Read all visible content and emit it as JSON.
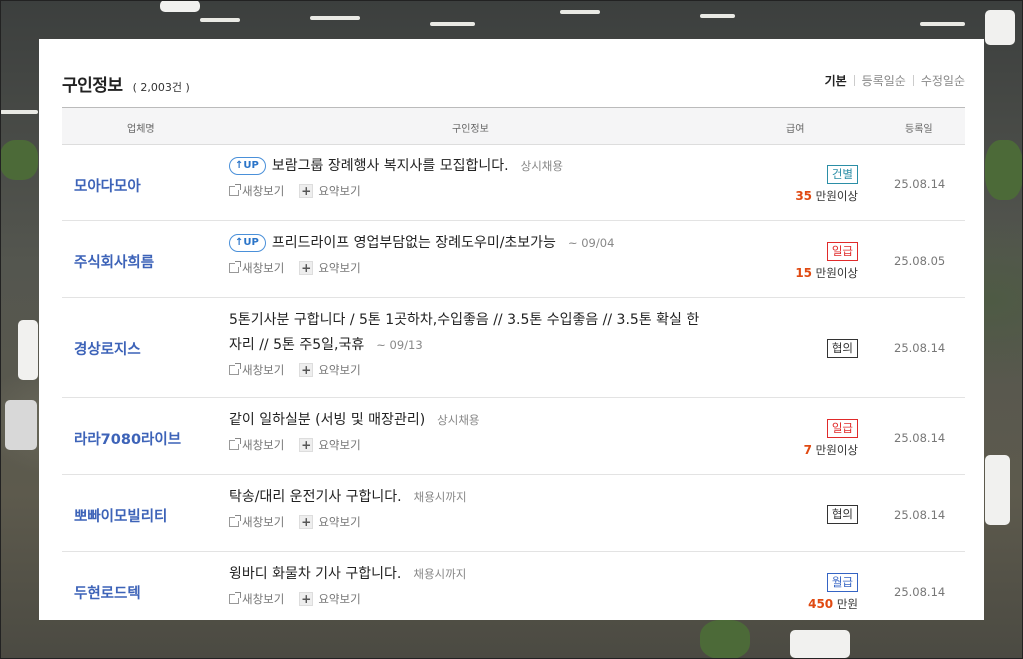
{
  "header": {
    "title": "구인정보",
    "count": "( 2,003건 )"
  },
  "sort_options": [
    {
      "label": "기본",
      "active": true
    },
    {
      "label": "등록일순",
      "active": false
    },
    {
      "label": "수정일순",
      "active": false
    }
  ],
  "columns": {
    "company": "업체명",
    "info": "구인정보",
    "pay": "급여",
    "date": "등록일"
  },
  "actions": {
    "new_window": "새창보기",
    "summary": "요약보기"
  },
  "up_label": "UP",
  "rows": [
    {
      "company": "모아다모아",
      "up": true,
      "title": "보람그룹 장례행사 복지사를 모집합니다.",
      "tag": "상시채용",
      "pay_type": "건별",
      "pay_amount": "35",
      "pay_unit": "만원이상",
      "date": "25.08.14"
    },
    {
      "company": "주식회사희름",
      "up": true,
      "title": "프리드라이프 영업부담없는 장례도우미/초보가능",
      "tag": "~ 09/04",
      "pay_type": "일급",
      "pay_amount": "15",
      "pay_unit": "만원이상",
      "date": "25.08.05"
    },
    {
      "company": "경상로지스",
      "up": false,
      "title": "5톤기사분 구합니다 / 5톤 1곳하차,수입좋음 // 3.5톤 수입좋음 // 3.5톤 확실 한자리 // 5톤 주5일,국휴",
      "tag": "~ 09/13",
      "pay_type": "협의",
      "pay_amount": "",
      "pay_unit": "",
      "date": "25.08.14"
    },
    {
      "company": "라라7080라이브",
      "up": false,
      "title": "같이 일하실분 (서빙 및 매장관리)",
      "tag": "상시채용",
      "pay_type": "일급",
      "pay_amount": "7",
      "pay_unit": "만원이상",
      "date": "25.08.14"
    },
    {
      "company": "뽀빠이모빌리티",
      "up": false,
      "title": "탁송/대리 운전기사 구합니다.",
      "tag": "채용시까지",
      "pay_type": "협의",
      "pay_amount": "",
      "pay_unit": "",
      "date": "25.08.14"
    },
    {
      "company": "두현로드텍",
      "up": false,
      "title": "윙바디 화물차 기사 구합니다.",
      "tag": "채용시까지",
      "pay_type": "월급",
      "pay_amount": "450",
      "pay_unit": "만원",
      "date": "25.08.14"
    }
  ],
  "colors": {
    "company": "#3d63b8",
    "amount": "#e04a12",
    "badge_teal": "#2b8ea6",
    "badge_red": "#e02a2a",
    "badge_blue": "#3564c4"
  }
}
